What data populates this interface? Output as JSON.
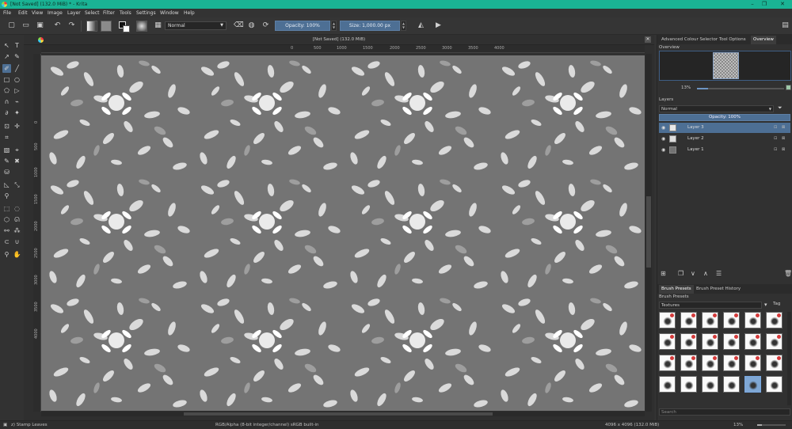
{
  "titlebar": {
    "title": "[Not Saved]  (132.0 MiB) * - Krita",
    "minimize": "–",
    "maximize": "❐",
    "close": "✕"
  },
  "menu": [
    "File",
    "Edit",
    "View",
    "Image",
    "Layer",
    "Select",
    "Filter",
    "Tools",
    "Settings",
    "Window",
    "Help"
  ],
  "toolbar": {
    "blend_mode": "Normal",
    "opacity": "Opacity:  100%",
    "size": "Size:  1,000.00 px"
  },
  "document": {
    "header_title": "[Not Saved]  (132.0 MiB)",
    "ruler_h": [
      "0",
      "500",
      "1000",
      "1500",
      "2000",
      "2500",
      "3000",
      "3500",
      "4000"
    ],
    "ruler_v": [
      "0",
      "500",
      "1000",
      "1500",
      "2000",
      "2500",
      "3000",
      "3500",
      "4000"
    ]
  },
  "docker": {
    "tabs": [
      "Advanced Colour Selector",
      "Tool Options",
      "Overview"
    ],
    "overview_label": "Overview",
    "zoom": "13%",
    "layers_label": "Layers",
    "layer_blend": "Normal",
    "layer_opacity": "Opacity:  100%",
    "layers": [
      {
        "name": "Layer 3",
        "selected": true
      },
      {
        "name": "Layer 2",
        "selected": false
      },
      {
        "name": "Layer 1",
        "selected": false
      }
    ],
    "brush_tabs": [
      "Brush Presets",
      "Brush Preset History"
    ],
    "brush_presets_label": "Brush Presets",
    "brush_filter": "Textures",
    "tag_label": "Tag",
    "search_placeholder": "Search"
  },
  "status": {
    "brush": "z) Stamp Leaves",
    "colorspace": "RGB/Alpha (8-bit integer/channel)  sRGB built-in",
    "dimensions": "4096 x 4096 (132.0 MiB)",
    "zoom": "13%"
  }
}
